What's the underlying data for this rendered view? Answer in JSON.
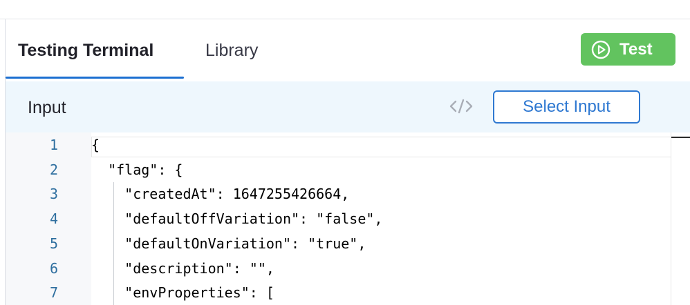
{
  "tabs": [
    {
      "label": "Testing Terminal",
      "active": true
    },
    {
      "label": "Library",
      "active": false
    }
  ],
  "test_button": {
    "label": "Test",
    "icon": "play-circle-icon",
    "color": "#62c35f"
  },
  "input_panel": {
    "title": "Input",
    "code_icon": "code-icon",
    "select_button_label": "Select Input"
  },
  "editor": {
    "line_numbers": [
      "1",
      "2",
      "3",
      "4",
      "5",
      "6",
      "7"
    ],
    "lines": [
      "{",
      "  \"flag\": {",
      "    \"createdAt\": 1647255426664,",
      "    \"defaultOffVariation\": \"false\",",
      "    \"defaultOnVariation\": \"true\",",
      "    \"description\": \"\",",
      "    \"envProperties\": ["
    ]
  },
  "colors": {
    "accent": "#1b6fd1",
    "header_bg": "#eef7fd",
    "line_number": "#2f6f9f"
  }
}
